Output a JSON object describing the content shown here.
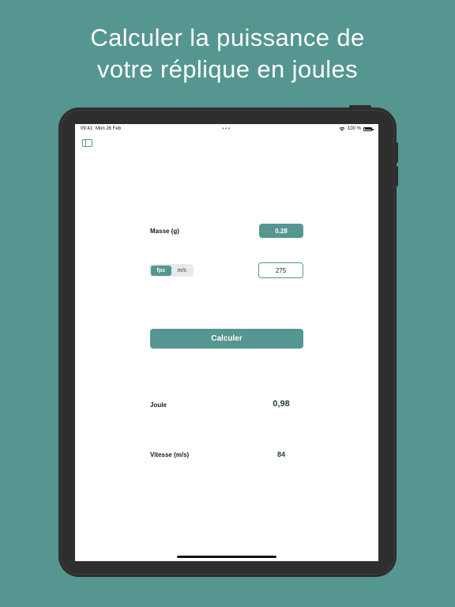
{
  "headline": {
    "line1": "Calculer la puissance de",
    "line2": "votre réplique en joules"
  },
  "status_bar": {
    "time": "09:41",
    "date": "Mon 26 Feb",
    "dots": "•••",
    "battery": "100 %"
  },
  "toolbar": {
    "sidebar_icon": "sidebar-icon"
  },
  "form": {
    "mass_label": "Masse (g)",
    "mass_value": "0.28",
    "units": [
      "fps",
      "m/s"
    ],
    "selected_unit": "fps",
    "speed_value": "275",
    "calculate_label": "Calculer"
  },
  "results": {
    "joule_label": "Joule",
    "joule_value": "0,98",
    "speed_label": "Vitesse (m/s)",
    "speed_value": "84"
  },
  "colors": {
    "accent": "#559690",
    "background": "#559690",
    "device": "#2e2e2e",
    "result_text": "#1f3d3a"
  }
}
